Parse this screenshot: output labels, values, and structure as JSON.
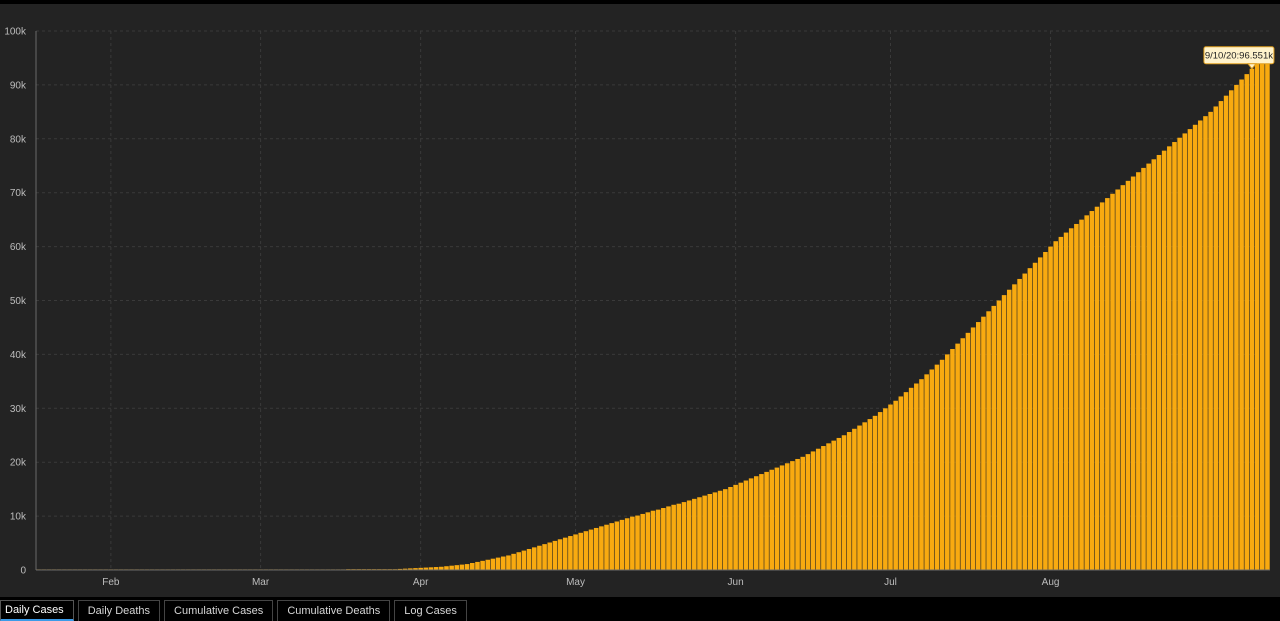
{
  "tabs": [
    {
      "label": "Daily Cases",
      "active": true
    },
    {
      "label": "Daily Deaths",
      "active": false
    },
    {
      "label": "Cumulative Cases",
      "active": false
    },
    {
      "label": "Cumulative Deaths",
      "active": false
    },
    {
      "label": "Log Cases",
      "active": false
    }
  ],
  "colors": {
    "bar": "#f8aa10",
    "background": "#232323",
    "grid": "#3a3a3a",
    "tooltip_bg": "#fff3cc",
    "tooltip_border": "#e0a020"
  },
  "tooltip": {
    "text": "9/10/20:96.551k",
    "series_index": 235
  },
  "chart_data": {
    "type": "bar",
    "x_type": "daily dates",
    "x_start_date": "2020-01-18",
    "x_end_date": "2020-09-10",
    "grid": true,
    "ylim": [
      0,
      100000
    ],
    "y_ticks": [
      {
        "value": 0,
        "label": "0"
      },
      {
        "value": 10000,
        "label": "10k"
      },
      {
        "value": 20000,
        "label": "20k"
      },
      {
        "value": 30000,
        "label": "30k"
      },
      {
        "value": 40000,
        "label": "40k"
      },
      {
        "value": 50000,
        "label": "50k"
      },
      {
        "value": 60000,
        "label": "60k"
      },
      {
        "value": 70000,
        "label": "70k"
      },
      {
        "value": 80000,
        "label": "80k"
      },
      {
        "value": 90000,
        "label": "90k"
      },
      {
        "value": 100000,
        "label": "100k"
      }
    ],
    "x_ticks": [
      {
        "date": "2020-02-01",
        "label": "Feb"
      },
      {
        "date": "2020-03-01",
        "label": "Mar"
      },
      {
        "date": "2020-04-01",
        "label": "Apr"
      },
      {
        "date": "2020-05-01",
        "label": "May"
      },
      {
        "date": "2020-06-01",
        "label": "Jun"
      },
      {
        "date": "2020-07-01",
        "label": "Jul"
      },
      {
        "date": "2020-08-01",
        "label": "Aug"
      }
    ],
    "values": [
      0,
      0,
      0,
      0,
      0,
      0,
      0,
      0,
      0,
      0,
      0,
      0,
      0,
      0,
      0,
      0,
      0,
      0,
      0,
      0,
      0,
      0,
      0,
      0,
      0,
      0,
      0,
      0,
      0,
      0,
      0,
      0,
      0,
      0,
      0,
      0,
      0,
      0,
      0,
      0,
      0,
      0,
      0,
      0,
      0,
      0,
      0,
      0,
      0,
      0,
      0,
      0,
      0,
      0,
      0,
      0,
      0,
      0,
      0,
      0,
      3,
      5,
      6,
      10,
      20,
      30,
      40,
      60,
      100,
      150,
      200,
      250,
      300,
      350,
      400,
      450,
      500,
      550,
      600,
      700,
      800,
      900,
      1000,
      1100,
      1300,
      1500,
      1700,
      1900,
      2100,
      2300,
      2500,
      2700,
      3000,
      3300,
      3600,
      3900,
      4200,
      4500,
      4800,
      5100,
      5400,
      5700,
      6000,
      6300,
      6600,
      6900,
      7200,
      7500,
      7800,
      8100,
      8400,
      8700,
      9000,
      9300,
      9600,
      9900,
      10100,
      10400,
      10700,
      11000,
      11200,
      11500,
      11800,
      12100,
      12300,
      12600,
      12900,
      13200,
      13500,
      13800,
      14100,
      14400,
      14700,
      15000,
      15400,
      15800,
      16200,
      16600,
      17000,
      17400,
      17800,
      18200,
      18600,
      19000,
      19400,
      19800,
      20200,
      20600,
      21000,
      21500,
      22000,
      22500,
      23000,
      23500,
      24000,
      24500,
      25000,
      25600,
      26200,
      26800,
      27400,
      28000,
      28600,
      29300,
      30000,
      30700,
      31400,
      32200,
      33000,
      33800,
      34600,
      35400,
      36300,
      37200,
      38100,
      39000,
      40000,
      41000,
      42000,
      43000,
      44000,
      45000,
      46000,
      47000,
      48000,
      49000,
      50000,
      51000,
      52000,
      53000,
      54000,
      55000,
      56000,
      57000,
      58000,
      59000,
      60000,
      61000,
      61800,
      62600,
      63400,
      64200,
      65000,
      65800,
      66600,
      67400,
      68200,
      69000,
      69800,
      70600,
      71400,
      72200,
      73000,
      73800,
      74600,
      75400,
      76200,
      77000,
      77800,
      78600,
      79400,
      80200,
      81000,
      81800,
      82600,
      83400,
      84200,
      85000,
      86000,
      87000,
      88000,
      89000,
      90000,
      91000,
      92000,
      93000,
      94000,
      95000,
      96551
    ]
  }
}
